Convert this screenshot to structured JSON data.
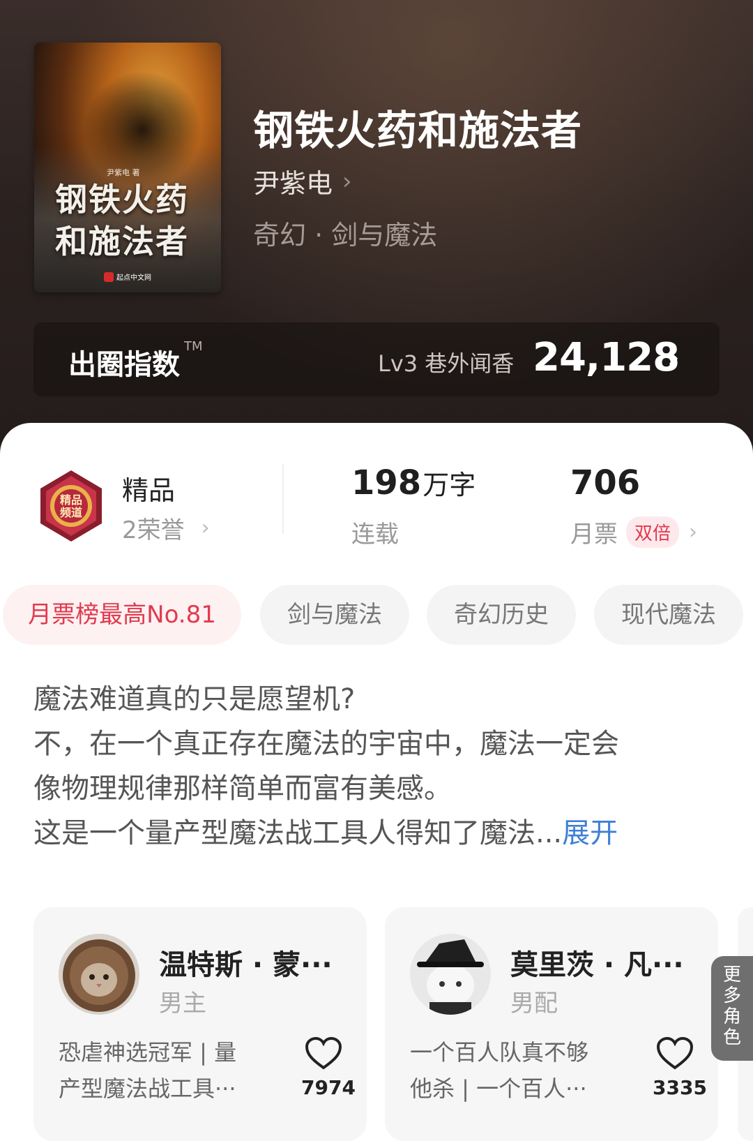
{
  "book": {
    "title": "钢铁火药和施法者",
    "author": "尹紫电",
    "genre": "奇幻 · 剑与魔法",
    "cover": {
      "title_line1": "钢铁火药",
      "title_line2": "和施法者",
      "author": "尹紫电 著",
      "publisher": "起点中文网"
    }
  },
  "index_bar": {
    "label": "出圈指数",
    "trademark": "TM",
    "level": "Lv3 巷外闻香",
    "score": "24,128"
  },
  "stats": {
    "honor_title": "精品",
    "honor_sub": "2荣誉",
    "words_value": "198",
    "words_unit": "万字",
    "words_sub": "连载",
    "votes_value": "706",
    "votes_sub": "月票",
    "votes_badge": "双倍"
  },
  "tags": [
    "月票榜最高No.81",
    "剑与魔法",
    "奇幻历史",
    "现代魔法"
  ],
  "synopsis": {
    "lines": [
      "魔法难道真的只是愿望机?",
      "不，在一个真正存在魔法的宇宙中，魔法一定会",
      "像物理规律那样简单而富有美感。",
      "这是一个量产型魔法战工具人得知了魔法..."
    ],
    "expand": "展开"
  },
  "roles": [
    {
      "name": "温特斯 · 蒙···",
      "type": "男主",
      "desc_line1": "恐虐神选冠军 | 量",
      "desc_line2": "产型魔法战工具···",
      "likes": "7974"
    },
    {
      "name": "莫里茨 · 凡···",
      "type": "男配",
      "desc_line1": "一个百人队真不够",
      "desc_line2": "他杀 | 一个百人···",
      "likes": "3335"
    }
  ],
  "more_roles": [
    "更",
    "多",
    "角",
    "色"
  ],
  "colors": {
    "accent_red": "#e13a4d",
    "link_blue": "#3e7fd6"
  }
}
